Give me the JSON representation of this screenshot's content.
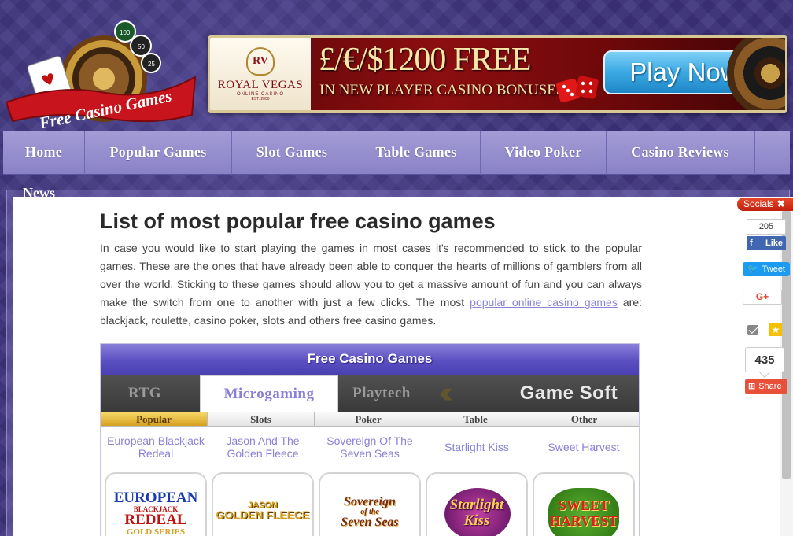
{
  "logo": {
    "ribbon_text": "Free Casino Games",
    "chip_labels": [
      "100",
      "50",
      "25"
    ]
  },
  "banner": {
    "brand_monogram": "RV",
    "brand_name": "ROYAL VEGAS",
    "brand_sub": "ONLINE CASINO",
    "brand_est": "EST. 2000",
    "headline": "£/€/$1200 FREE",
    "subline": "IN NEW PLAYER CASINO BONUSES!",
    "cta": "Play Now"
  },
  "nav": {
    "items": [
      "Home",
      "Popular Games",
      "Slot Games",
      "Table Games",
      "Video Poker",
      "Casino Reviews"
    ],
    "overflow_item": "News"
  },
  "article": {
    "title": "List of most popular free casino games",
    "intro_text": "In case you would like to start playing the games in most cases it's recommended to stick to the popular games. These are the ones that have already been able to conquer the hearts of millions of gamblers from all over the world. Sticking to these games should allow you to get a massive amount of fun and you can always make the switch from one to another with just a few clicks. The most ",
    "intro_link": "popular online casino games",
    "intro_tail": " are: blackjack, roulette, casino poker, slots and others free casino games."
  },
  "widget": {
    "header": "Free Casino Games",
    "providers": [
      "RTG",
      "Microgaming",
      "Playtech",
      "Game Soft"
    ],
    "active_provider": "Microgaming",
    "categories": [
      "Popular",
      "Slots",
      "Poker",
      "Table",
      "Other"
    ],
    "active_category": "Popular",
    "games": [
      {
        "name": "European Blackjack Redeal",
        "logo_lines": [
          "EUROPEAN",
          "BLACKJACK",
          "REDEAL",
          "GOLD SERIES"
        ]
      },
      {
        "name": "Jason And The Golden Fleece",
        "logo_lines": [
          "JASON",
          "GOLDEN FLEECE"
        ]
      },
      {
        "name": "Sovereign Of The Seven Seas",
        "logo_lines": [
          "Sovereign",
          "of the",
          "Seven Seas"
        ]
      },
      {
        "name": "Starlight Kiss",
        "logo_lines": [
          "Starlight",
          "Kiss"
        ]
      },
      {
        "name": "Sweet Harvest",
        "logo_lines": [
          "SWEET",
          "HARVEST"
        ]
      }
    ]
  },
  "socials": {
    "panel_label": "Socials",
    "close_glyph": "✖",
    "fb_count": "205",
    "fb_like": "Like",
    "tweet": "Tweet",
    "gplus": "G+",
    "share_count": "435",
    "share_label": "Share"
  },
  "colors": {
    "background": "#3c327a",
    "nav": "#958ecf",
    "accent": "#8a82d6",
    "banner_red": "#8c0e10"
  }
}
